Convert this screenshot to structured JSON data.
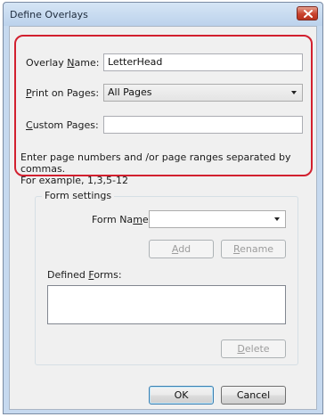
{
  "window": {
    "title": "Define Overlays"
  },
  "overlay": {
    "name_label_pre": "Overlay ",
    "name_label_accel": "N",
    "name_label_post": "ame:",
    "name_value": "LetterHead",
    "print_label_accel": "P",
    "print_label_post": "rint on Pages:",
    "print_value": "All Pages",
    "custom_label_accel": "C",
    "custom_label_post": "ustom Pages:",
    "custom_value": "",
    "note_line1": "Enter page numbers and /or page ranges separated by commas.",
    "note_line2": "For example, 1,3,5-12"
  },
  "form_settings": {
    "group_label": "Form settings",
    "form_name_label_pre": "Form Na",
    "form_name_label_accel": "m",
    "form_name_label_post": "e:",
    "form_name_value": "",
    "add_label_accel": "A",
    "add_label_post": "dd",
    "rename_label_accel": "R",
    "rename_label_post": "ename",
    "defined_label_pre": "Defined ",
    "defined_label_accel": "F",
    "defined_label_post": "orms:",
    "defined_items": [],
    "delete_label_accel": "D",
    "delete_label_post": "elete"
  },
  "footer": {
    "ok_label": "OK",
    "cancel_label": "Cancel"
  },
  "colors": {
    "highlight_border": "#d2202f",
    "close_button": "#c9422e",
    "window_frame": "#c6d9ef",
    "dialog_face": "#f0f0f0"
  },
  "icons": {
    "close": "close-icon",
    "dropdown": "chevron-down-icon"
  }
}
